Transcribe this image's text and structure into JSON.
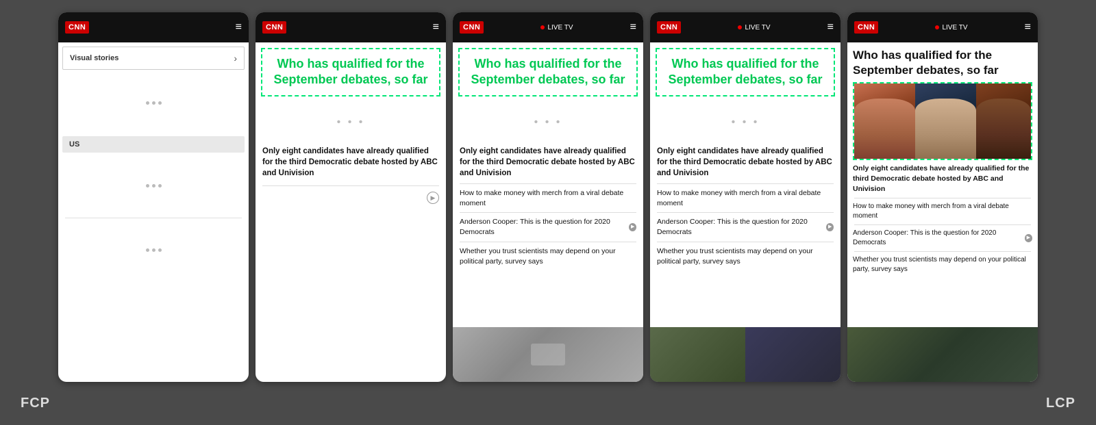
{
  "label_fcp": "FCP",
  "label_lcp": "LCP",
  "cnn": {
    "logo": "CNN",
    "live_tv": "LIVE TV",
    "hamburger": "≡"
  },
  "phones": [
    {
      "id": "phone1",
      "type": "fcp",
      "header": {
        "show_live": false
      },
      "visual_stories_label": "Visual stories",
      "chevron": "›",
      "us_label": "US",
      "loading_sections": 3
    },
    {
      "id": "phone2",
      "type": "partial",
      "header": {
        "show_live": false
      },
      "headline": "Who has qualified for the September debates, so far",
      "headline_colored": true,
      "article_text": "Only eight candidates have already qualified for the third Democratic debate hosted by ABC and Univision",
      "show_articles": false,
      "show_bottom_image": false
    },
    {
      "id": "phone3",
      "type": "more_content",
      "header": {
        "show_live": true
      },
      "headline": "Who has qualified for the September debates, so far",
      "headline_colored": true,
      "article_text": "Only eight candidates have already qualified for the third Democratic debate hosted by ABC and Univision",
      "articles": [
        "How to make money with merch from a viral debate moment",
        "Anderson Cooper: This is the question for 2020 Democrats",
        "Whether you trust scientists may depend on your political party, survey says"
      ],
      "show_bottom_image": true,
      "bottom_image_type": "gray"
    },
    {
      "id": "phone4",
      "type": "more_content",
      "header": {
        "show_live": true
      },
      "headline": "Who has qualified for the September debates, so far",
      "headline_colored": true,
      "article_text": "Only eight candidates have already qualified for the third Democratic debate hosted by ABC and Univision",
      "articles": [
        "How to make money with merch from a viral debate moment",
        "Anderson Cooper: This is the question for 2020 Democrats",
        "Whether you trust scientists may depend on your political party, survey says"
      ],
      "show_bottom_image": true,
      "bottom_image_type": "dark"
    },
    {
      "id": "phone5",
      "type": "lcp",
      "header": {
        "show_live": true
      },
      "headline": "Who has qualified for the September debates, so far",
      "headline_colored": false,
      "article_text": "Only eight candidates have already qualified for the third Democratic debate hosted by ABC and Univision",
      "articles": [
        "How to make money with merch from a viral debate moment",
        "Anderson Cooper: This is the question for 2020 Democrats",
        "Whether you trust scientists may depend on your political party, survey says"
      ],
      "show_hero_image": true,
      "show_bottom_image": true,
      "bottom_image_type": "dark"
    }
  ]
}
